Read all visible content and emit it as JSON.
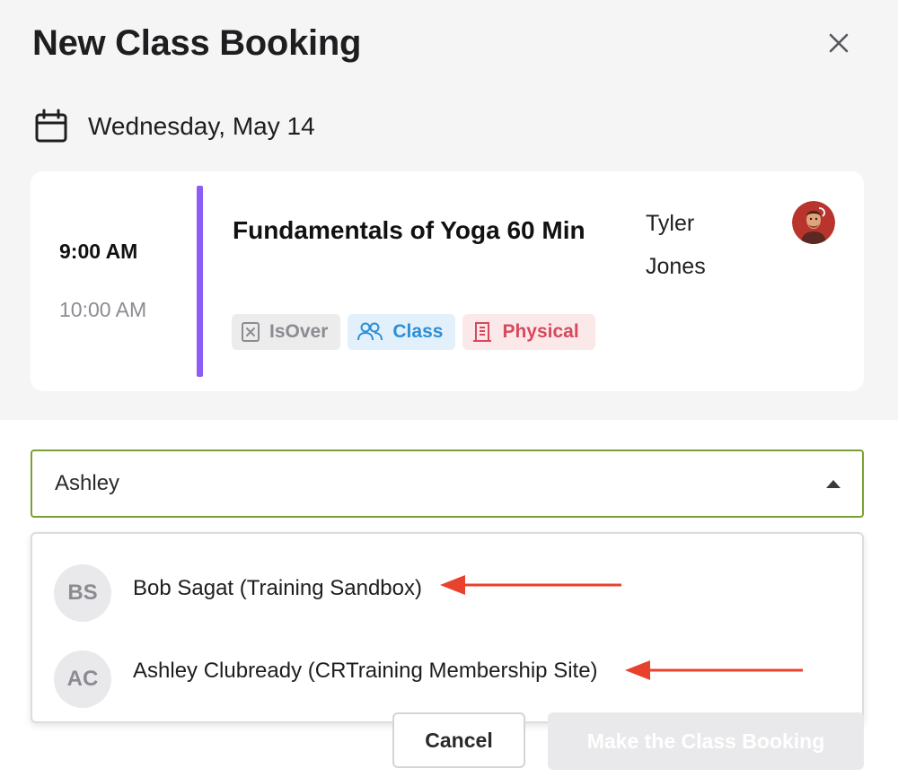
{
  "dialog": {
    "title": "New Class Booking",
    "close_icon": "close-icon",
    "date_icon": "calendar-icon",
    "date": "Wednesday, May 14"
  },
  "class_card": {
    "start_time": "9:00 AM",
    "end_time": "10:00 AM",
    "name": "Fundamentals of Yoga 60 Min",
    "accent_color": "#8b5cf6",
    "instructor": "Tyler Jones",
    "tags": [
      {
        "label": "IsOver",
        "icon": "x-square-icon",
        "color": "#8a8c91"
      },
      {
        "label": "Class",
        "icon": "people-icon",
        "color": "#2b8fd6"
      },
      {
        "label": "Physical",
        "icon": "building-icon",
        "color": "#d9485c"
      }
    ]
  },
  "client_select": {
    "value": "Ashley",
    "border_color": "#7aa033",
    "expanded": true,
    "options": [
      {
        "initials": "BS",
        "label": "Bob Sagat (Training Sandbox)"
      },
      {
        "initials": "AC",
        "label": "Ashley Clubready (CRTraining Membership Site)"
      }
    ]
  },
  "annotations": {
    "arrow_color": "#e8412c"
  },
  "footer": {
    "cancel_label": "Cancel",
    "submit_label": "Make the Class Booking"
  }
}
